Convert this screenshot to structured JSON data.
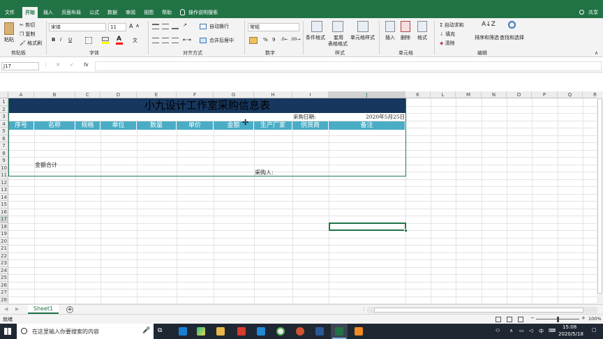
{
  "tabs": [
    {
      "label": "文件",
      "active": false
    },
    {
      "label": "开始",
      "active": true
    },
    {
      "label": "插入",
      "active": false
    },
    {
      "label": "页面布局",
      "active": false
    },
    {
      "label": "公式",
      "active": false
    },
    {
      "label": "数据",
      "active": false
    },
    {
      "label": "审阅",
      "active": false
    },
    {
      "label": "视图",
      "active": false
    },
    {
      "label": "帮助",
      "active": false
    }
  ],
  "tell_me": "操作说明搜索",
  "share": "共享",
  "ribbon": {
    "clipboard": {
      "paste": "粘贴",
      "cut": "剪切",
      "copy": "复制",
      "format_painter": "格式刷",
      "group": "剪贴板"
    },
    "font": {
      "name": "宋体",
      "size": "11",
      "bold": "B",
      "italic": "I",
      "underline": "U",
      "group": "字体"
    },
    "alignment": {
      "wrap": "自动换行",
      "merge": "合并后居中",
      "group": "对齐方式"
    },
    "number": {
      "format": "常规",
      "percent": "%",
      "comma": "9",
      "group": "数字"
    },
    "styles": {
      "conditional": "条件格式",
      "table_line1": "套用",
      "table_line2": "表格格式",
      "cell_styles": "单元格样式",
      "group": "样式"
    },
    "cells": {
      "insert": "插入",
      "delete": "删除",
      "format": "格式",
      "group": "单元格"
    },
    "editing": {
      "autosum": "自动求和",
      "fill": "填充",
      "clear": "清除",
      "sort": "排序和筛选",
      "find": "查找和选择",
      "group": "编辑"
    }
  },
  "formula_bar": {
    "name_box": "J17",
    "fx": "fx",
    "value": ""
  },
  "columns": [
    "A",
    "B",
    "C",
    "D",
    "E",
    "F",
    "G",
    "H",
    "I",
    "J",
    "K",
    "L",
    "M",
    "N",
    "O",
    "P",
    "Q",
    "R"
  ],
  "rows": [
    "1",
    "2",
    "3",
    "4",
    "5",
    "6",
    "7",
    "8",
    "9",
    "10",
    "11",
    "12",
    "13",
    "14",
    "15",
    "16",
    "17",
    "18",
    "19",
    "20",
    "21",
    "22",
    "23",
    "24",
    "25",
    "26",
    "27",
    "28"
  ],
  "table": {
    "title": "小九设计工作室采购信息表",
    "date_label": "采购日期:",
    "date_value": "2020年5月25日",
    "headers": [
      "序号",
      "名称",
      "规格",
      "单位",
      "数量",
      "单价",
      "金额",
      "生产厂家",
      "供货商",
      "备注"
    ],
    "total_label": "金额合计",
    "buyer_label": "采购人:",
    "header_color": "#4bacc6",
    "title_color": "#17375e"
  },
  "sheet_tabs": [
    {
      "label": "Sheet1",
      "active": true
    }
  ],
  "status": {
    "ready": "就绪",
    "zoom": "100%"
  },
  "taskbar": {
    "search_placeholder": "在这里输入你要搜索的内容",
    "time": "15:08",
    "date": "2020/5/18",
    "ime": "中"
  }
}
